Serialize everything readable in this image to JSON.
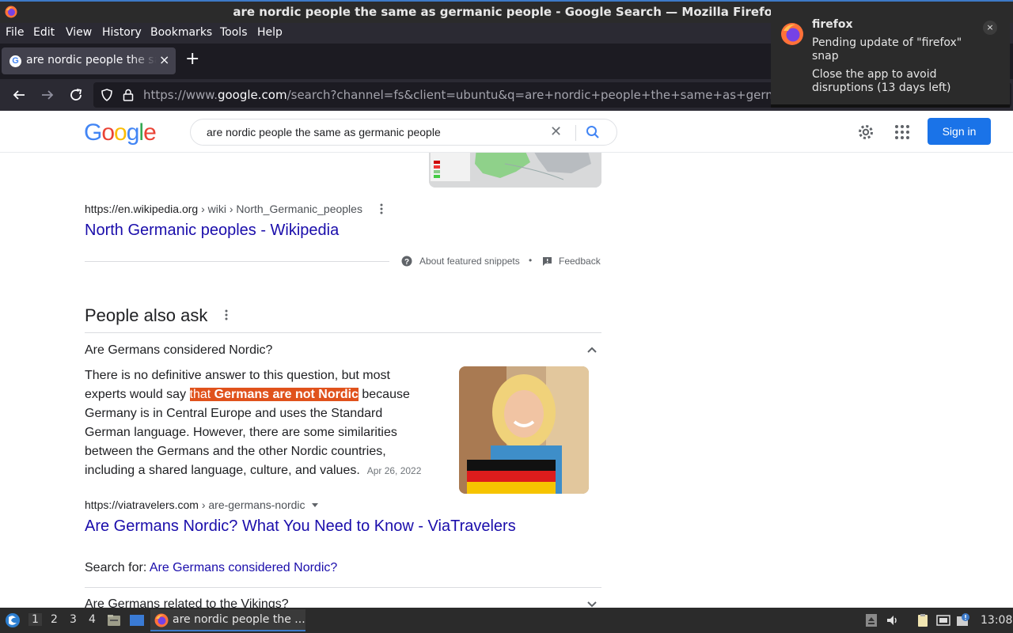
{
  "window": {
    "title": "are nordic people the same as germanic people - Google Search — Mozilla Firefox"
  },
  "menu": [
    "File",
    "Edit",
    "View",
    "History",
    "Bookmarks",
    "Tools",
    "Help"
  ],
  "tab": {
    "title": "are nordic people the same as germanic people",
    "close": "×",
    "new_tab": "+"
  },
  "url": {
    "prefix": "https://www.",
    "domain": "google.com",
    "path": "/search?channel=fs&client=ubuntu&q=are+nordic+people+the+same+as+germanic+people"
  },
  "notification": {
    "title": "firefox",
    "body1": "Pending update of \"firefox\" snap",
    "body2": "Close the app to avoid disruptions (13 days left)",
    "close": "×"
  },
  "google": {
    "logo": [
      "G",
      "o",
      "o",
      "g",
      "l",
      "e"
    ],
    "logo_colors": [
      "#4285f4",
      "#ea4335",
      "#fbbc05",
      "#4285f4",
      "#34a853",
      "#ea4335"
    ],
    "query": "are nordic people the same as germanic people",
    "clear": "✕",
    "sign_in": "Sign in"
  },
  "result1": {
    "url": "https://en.wikipedia.org",
    "crumb": " › wiki › North_Germanic_peoples",
    "title": "North Germanic peoples - Wikipedia"
  },
  "snippet_meta": {
    "about": "About featured snippets",
    "dot": "•",
    "feedback": "Feedback"
  },
  "paa": {
    "title": "People also ask",
    "q1": "Are Germans considered Nordic?",
    "answer_pre": "There is no definitive answer to this question, but most experts would say ",
    "answer_hl_plain": "that ",
    "answer_hl_bold": "Germans are not Nordic",
    "answer_post": " because Germany is in Central Europe and uses the Standard German language. However, there are some similarities between the Germans and the other Nordic countries, including a shared language, culture, and values.",
    "date": "Apr 26, 2022",
    "source_url": "https://viatravelers.com",
    "source_crumb": " › are-germans-nordic",
    "source_title": "Are Germans Nordic? What You Need to Know - ViaTravelers",
    "search_for_label": "Search for: ",
    "search_for_link": "Are Germans considered Nordic?",
    "q2": "Are Germans related to the Vikings?"
  },
  "taskbar": {
    "workspaces": [
      "1",
      "2",
      "3",
      "4"
    ],
    "task_label": "are nordic people the ...",
    "clock": "13:08"
  }
}
